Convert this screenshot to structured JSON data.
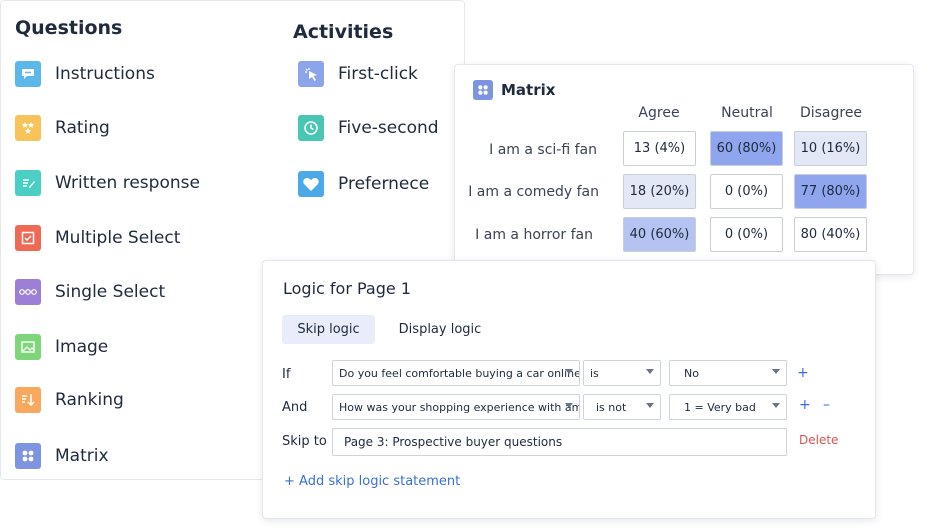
{
  "questions": {
    "title": "Questions",
    "items": [
      {
        "label": "Instructions",
        "icon": "speech-bubble-icon",
        "color": "#5bb8e8"
      },
      {
        "label": "Rating",
        "icon": "star-icon",
        "color": "#f7c35a"
      },
      {
        "label": "Written response",
        "icon": "pencil-icon",
        "color": "#49cfc4"
      },
      {
        "label": "Multiple Select",
        "icon": "checkbox-icon",
        "color": "#ef6a55"
      },
      {
        "label": "Single Select",
        "icon": "radio-dots-icon",
        "color": "#9e7fd8"
      },
      {
        "label": "Image",
        "icon": "image-icon",
        "color": "#7fd57a"
      },
      {
        "label": "Ranking",
        "icon": "sort-down-icon",
        "color": "#f8a95e"
      },
      {
        "label": "Matrix",
        "icon": "grid-icon",
        "color": "#7d94e0"
      }
    ]
  },
  "activities": {
    "title": "Activities",
    "items": [
      {
        "label": "First-click",
        "icon": "cursor-click-icon",
        "color": "#8ca4ec"
      },
      {
        "label": "Five-second",
        "icon": "clock-icon",
        "color": "#49c7b4"
      },
      {
        "label": "Prefernece",
        "icon": "heart-icon",
        "color": "#4aa9e6"
      }
    ]
  },
  "matrix": {
    "title": "Matrix",
    "columns": [
      "Agree",
      "Neutral",
      "Disagree"
    ],
    "rows": [
      {
        "label": "I am a sci-fi fan",
        "cells": [
          {
            "text": "13 (4%)",
            "fill": "#ffffff"
          },
          {
            "text": "60 (80%)",
            "fill": "#8fa6ee"
          },
          {
            "text": "10 (16%)",
            "fill": "#e3e8f6"
          }
        ]
      },
      {
        "label": "I am a comedy fan",
        "cells": [
          {
            "text": "18 (20%)",
            "fill": "#e3e8f6"
          },
          {
            "text": "0 (0%)",
            "fill": "#ffffff"
          },
          {
            "text": "77 (80%)",
            "fill": "#8fa6ee"
          }
        ]
      },
      {
        "label": "I am a horror fan",
        "cells": [
          {
            "text": "40 (60%)",
            "fill": "#b4c3f2"
          },
          {
            "text": "0 (0%)",
            "fill": "#ffffff"
          },
          {
            "text": "80 (40%)",
            "fill": "#ffffff"
          }
        ]
      }
    ]
  },
  "logic": {
    "title": "Logic for Page 1",
    "tabs": {
      "skip": "Skip logic",
      "display": "Display logic"
    },
    "rows": [
      {
        "label": "If",
        "question": "Do you feel comfortable buying a car online",
        "operator": "is",
        "answer": "No"
      },
      {
        "label": "And",
        "question": "How was your shopping experience with am",
        "operator": "is not",
        "answer": "1 = Very bad"
      }
    ],
    "skip_label": "Skip to",
    "skip_target": "Page 3: Prospective buyer questions",
    "plus": "+",
    "minus": "–",
    "delete": "Delete",
    "add_statement": "+ Add skip logic statement"
  }
}
